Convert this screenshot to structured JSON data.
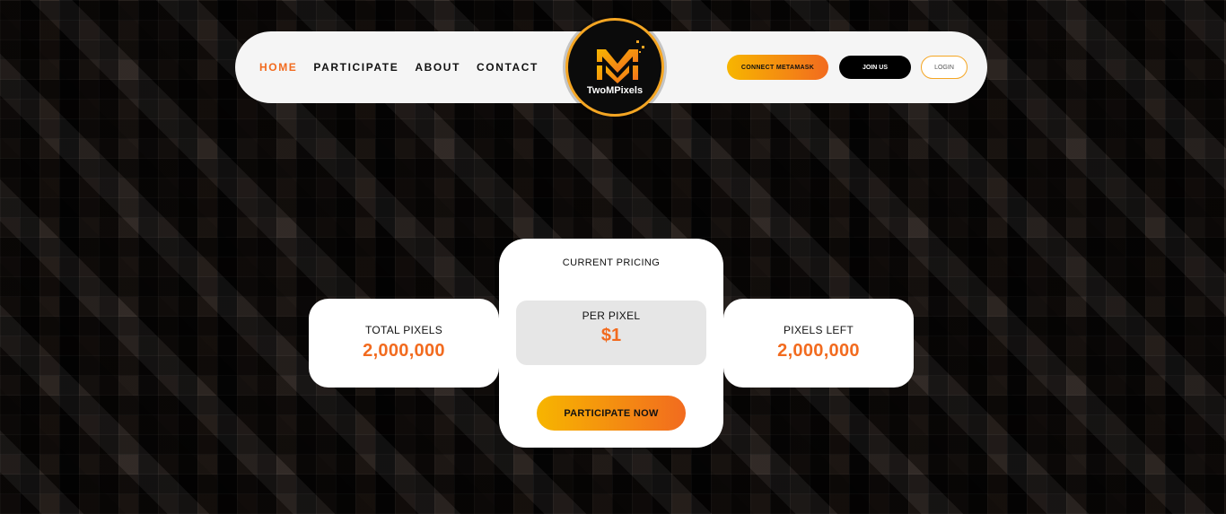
{
  "nav": {
    "items": [
      {
        "label": "HOME",
        "active": true
      },
      {
        "label": "PARTICIPATE",
        "active": false
      },
      {
        "label": "ABOUT",
        "active": false
      },
      {
        "label": "CONTACT",
        "active": false
      }
    ]
  },
  "logo": {
    "text": "TwoMPixels",
    "icon": "mm-logo-icon"
  },
  "header_buttons": {
    "connect": "CONNECT METAMASK",
    "join": "JOIN US",
    "login": "LOGIN"
  },
  "stats": {
    "total": {
      "label": "TOTAL PIXELS",
      "value": "2,000,000"
    },
    "left": {
      "label": "PIXELS LEFT",
      "value": "2,000,000"
    }
  },
  "pricing": {
    "title": "CURRENT PRICING",
    "per_label": "PER PIXEL",
    "per_value": "$1",
    "cta": "PARTICIPATE NOW"
  },
  "colors": {
    "accent": "#f26b1f",
    "gradient_start": "#f7b500",
    "nav_bg": "#f5f5f5",
    "logo_ring": "#f5a623"
  }
}
